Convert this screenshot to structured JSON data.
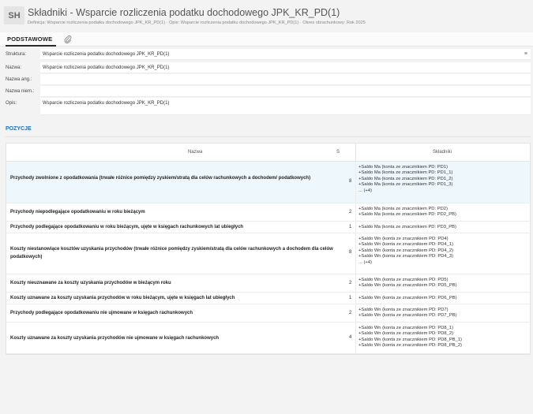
{
  "header": {
    "avatar": "SH",
    "title": "Składniki - Wsparcie rozliczenia podatku dochodowego JPK_KR_PD(1)",
    "subtitle": "Definicja: Wsparcie rozliczenia podatku dochodowego JPK_KR_PD(1)  ·  Opis: Wsparcie rozliczenia podatku dochodowego JPK_KR_PD(1)  ·  Okres obrachunkowy: Rok 2025"
  },
  "tabs": {
    "basic": "PODSTAWOWE",
    "attachment_icon": "paperclip-icon"
  },
  "form": {
    "menu_icon": "≡",
    "fields": [
      {
        "label": "Struktura:",
        "value": "Wsparcie rozliczenia podatku dochodowego JPK_KR_PD(1)"
      },
      {
        "label": "Nazwa:",
        "value": "Wsparcie rozliczenia podatku dochodowego JPK_KR_PD(1)"
      },
      {
        "label": "Nazwa ang.:",
        "value": ""
      },
      {
        "label": "Nazwa niem.:",
        "value": ""
      },
      {
        "label": "Opis:",
        "value": "Wsparcie rozliczenia podatku dochodowego JPK_KR_PD(1)"
      }
    ]
  },
  "positions": {
    "section_title": "POZYCJE",
    "columns": {
      "name": "Nazwa",
      "s": "S",
      "components": "Składniki"
    },
    "rows": [
      {
        "name": "Przychody zwolnione z opodatkowania (trwałe różnice pomiędzy zyskiem/stratą dla celów rachunkowych a dochodem/ podatkowych)",
        "s": "8",
        "components": [
          "+Saldo Ma (konta ze znacznikiem PD: PD1)",
          "+Saldo Ma (konta ze znacznikiem PD: PD1_1)",
          "+Saldo Ma (konta ze znacznikiem PD: PD1_2)",
          "+Saldo Ma (konta ze znacznikiem PD: PD1_3)",
          "... (+4)"
        ]
      },
      {
        "name": "Przychody niepodlegające opodatkowaniu w roku bieżącym",
        "s": "2",
        "components": [
          "+Saldo Ma (konta ze znacznikiem PD: PD2)",
          "+Saldo Ma (konta ze znacznikiem PD: PD2_PB)"
        ]
      },
      {
        "name": "Przychody podlegające opodatkowaniu w roku bieżącym, ujęte w księgach rachunkowych lat ubiegłych",
        "s": "1",
        "components": [
          "+Saldo Ma (konta ze znacznikiem PD: PD3_PB)"
        ]
      },
      {
        "name": "Koszty niestanowiące kosztów uzyskania przychodów (trwałe różnice pomiędzy zyskiem/stratą dla celów rachunkowych a dochodem dla celów podatkowych)",
        "s": "8",
        "components": [
          "+Saldo Wn (konta ze znacznikiem PD: PD4)",
          "+Saldo Wn (konta ze znacznikiem PD: PD4_1)",
          "+Saldo Wn (konta ze znacznikiem PD: PD4_2)",
          "+Saldo Wn (konta ze znacznikiem PD: PD4_3)",
          "... (+4)"
        ]
      },
      {
        "name": "Koszty nieuznawane za koszty uzyskania przychodów w bieżącym roku",
        "s": "2",
        "components": [
          "+Saldo Wn (konta ze znacznikiem PD: PD5)",
          "+Saldo Wn (konta ze znacznikiem PD: PD5_PB)"
        ]
      },
      {
        "name": "Koszty uznawane za koszty uzyskania przychodów w roku bieżącym, ujęte w księgach lat ubiegłych",
        "s": "1",
        "components": [
          "+Saldo Wn (konta ze znacznikiem PD: PD6_PB)"
        ]
      },
      {
        "name": "Przychody podlegające opodatkowaniu nie ujmowane w księgach rachunkowych",
        "s": "2",
        "components": [
          "+Saldo Wn (konta ze znacznikiem PD: PD7)",
          "+Saldo Wn (konta ze znacznikiem PD: PD7_PB)"
        ]
      },
      {
        "name": "Koszty uznawane za koszty uzyskania przychodów nie ujmowane w księgach rachunkowych",
        "s": "4",
        "components": [
          "+Saldo Wn (konta ze znacznikiem PD: PD8_1)",
          "+Saldo Wn (konta ze znacznikiem PD: PD8_2)",
          "+Saldo Wn (konta ze znacznikiem PD: PD8_PB_1)",
          "+Saldo Wn (konta ze znacznikiem PD: PD8_PB_2)"
        ]
      }
    ]
  }
}
